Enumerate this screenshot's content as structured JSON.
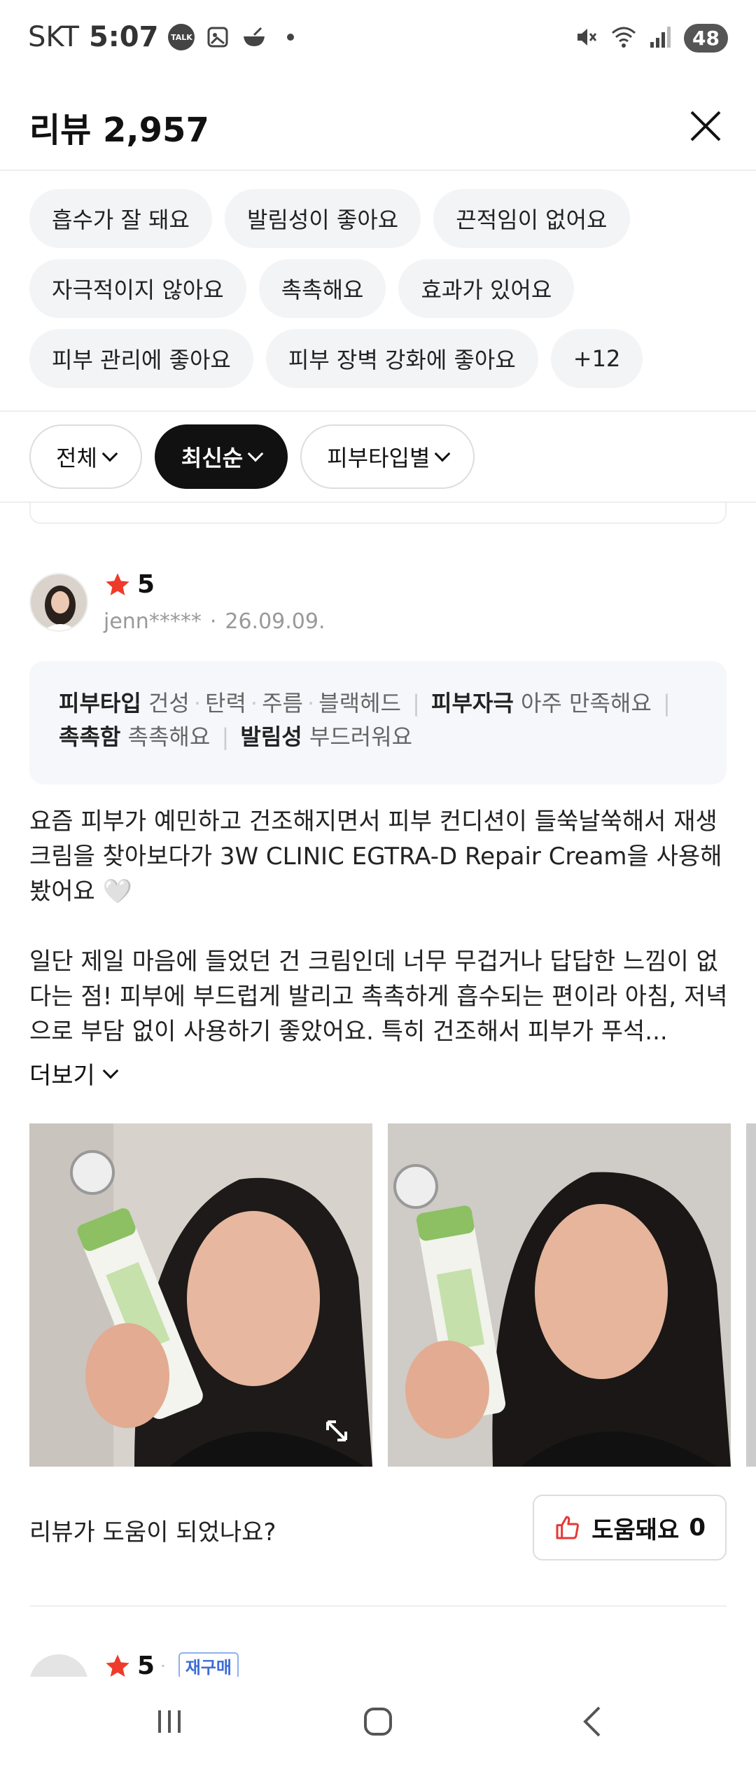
{
  "status_bar": {
    "carrier": "SKT",
    "time": "5:07",
    "talk_label": "TALK",
    "battery": "48"
  },
  "header": {
    "title": "리뷰 2,957"
  },
  "keywords": [
    "흡수가 잘 돼요",
    "발림성이 좋아요",
    "끈적임이 없어요",
    "자극적이지 않아요",
    "촉촉해요",
    "효과가 있어요",
    "피부 관리에 좋아요",
    "피부 장벽 강화에 좋아요",
    "+12"
  ],
  "filters": {
    "all": "전체",
    "sort": "최신순",
    "skin_type": "피부타입별"
  },
  "review": {
    "rating": "5",
    "author": "jenn*****",
    "date": "26.09.09.",
    "attr": {
      "skin_type_label": "피부타입",
      "skin_type_tags": [
        "건성",
        "탄력",
        "주름",
        "블랙헤드"
      ],
      "irritation_label": "피부자극",
      "irritation_value": "아주 만족해요",
      "moisture_label": "촉촉함",
      "moisture_value": "촉촉해요",
      "spread_label": "발림성",
      "spread_value": "부드러워요"
    },
    "paragraph1": "요즘 피부가 예민하고 건조해지면서 피부 컨디션이 들쑥날쑥해서 재생크림을 찾아보다가 3W CLINIC EGTRA-D Repair Cream을 사용해봤어요 🤍",
    "paragraph2": "일단 제일 마음에 들었던 건 크림인데 너무 무겁거나 답답한 느낌이 없다는 점! 피부에 부드럽게 발리고 촉촉하게 흡수되는 편이라 아침, 저녁으로 부담 없이 사용하기 좋았어요. 특히 건조해서 피부가 푸석...",
    "more_label": "더보기",
    "helpful_question": "리뷰가 도움이 되었나요?",
    "helpful_label": "도움돼요",
    "helpful_count": "0"
  },
  "next_review": {
    "rating": "5",
    "badge": "재구매"
  },
  "colors": {
    "star": "#ee3b2b",
    "thumb": "#e53935",
    "badge": "#3d6cd6"
  }
}
